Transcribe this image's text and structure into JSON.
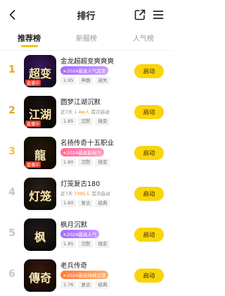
{
  "header": {
    "title": "排行"
  },
  "tabs": [
    {
      "label": "推荐榜"
    },
    {
      "label": "新服榜"
    },
    {
      "label": "人气榜"
    }
  ],
  "items": [
    {
      "rank": "1",
      "rank_color": "#f0a020",
      "name": "金龙超超变爽爽爽",
      "badge": "2024最具人气超变",
      "badge_style": "",
      "meta": "",
      "tags": [
        "1.95",
        "神器",
        "迷失"
      ],
      "logo": "超变",
      "thumb_bg": "#3b1b64",
      "button": "启动"
    },
    {
      "rank": "2",
      "rank_color": "#f0a020",
      "name": "圆梦江湖沉默",
      "badge": "",
      "badge_style": "",
      "meta_prefix": "近7天",
      "meta_hot": "1.4w人",
      "meta_suffix": "首次启动",
      "tags": [
        "1.85",
        "沉默",
        "微变"
      ],
      "logo": "江湖",
      "thumb_bg": "#1b1411",
      "button": "启动"
    },
    {
      "rank": "3",
      "rank_color": "#f2c230",
      "name": "名扬传奇十五职业",
      "badge": "2024最具影响力",
      "badge_style": "pink",
      "tags": [
        "1.80",
        "沉默",
        "微变"
      ],
      "logo": "龍",
      "thumb_bg": "#2a1a09",
      "button": "启动"
    },
    {
      "rank": "4",
      "rank_color": "#c7c7c7",
      "name": "灯笼复古180",
      "badge": "",
      "badge_style": "",
      "meta_prefix": "近7天",
      "meta_hot": "7395人",
      "meta_suffix": "首次启动",
      "tags": [
        "1.80",
        "复古",
        "经典"
      ],
      "logo": "灯笼",
      "thumb_bg": "#2b2218",
      "button": "启动"
    },
    {
      "rank": "5",
      "rank_color": "#c7c7c7",
      "name": "枫月沉默",
      "badge": "2024最具人气",
      "badge_style": "",
      "tags": [
        "1.85",
        "沉默",
        "微变"
      ],
      "logo": "枫",
      "thumb_bg": "#231d1a",
      "button": "启动"
    },
    {
      "rank": "6",
      "rank_color": "#c7c7c7",
      "name": "老兵传奇",
      "badge": "2024最佳持续运营",
      "badge_style": "fire",
      "tags": [
        "1.76",
        "复古",
        "经典"
      ],
      "logo": "傳奇",
      "thumb_bg": "#3a1a0f",
      "button": "启动"
    }
  ],
  "thumb_live_label": "直播中"
}
